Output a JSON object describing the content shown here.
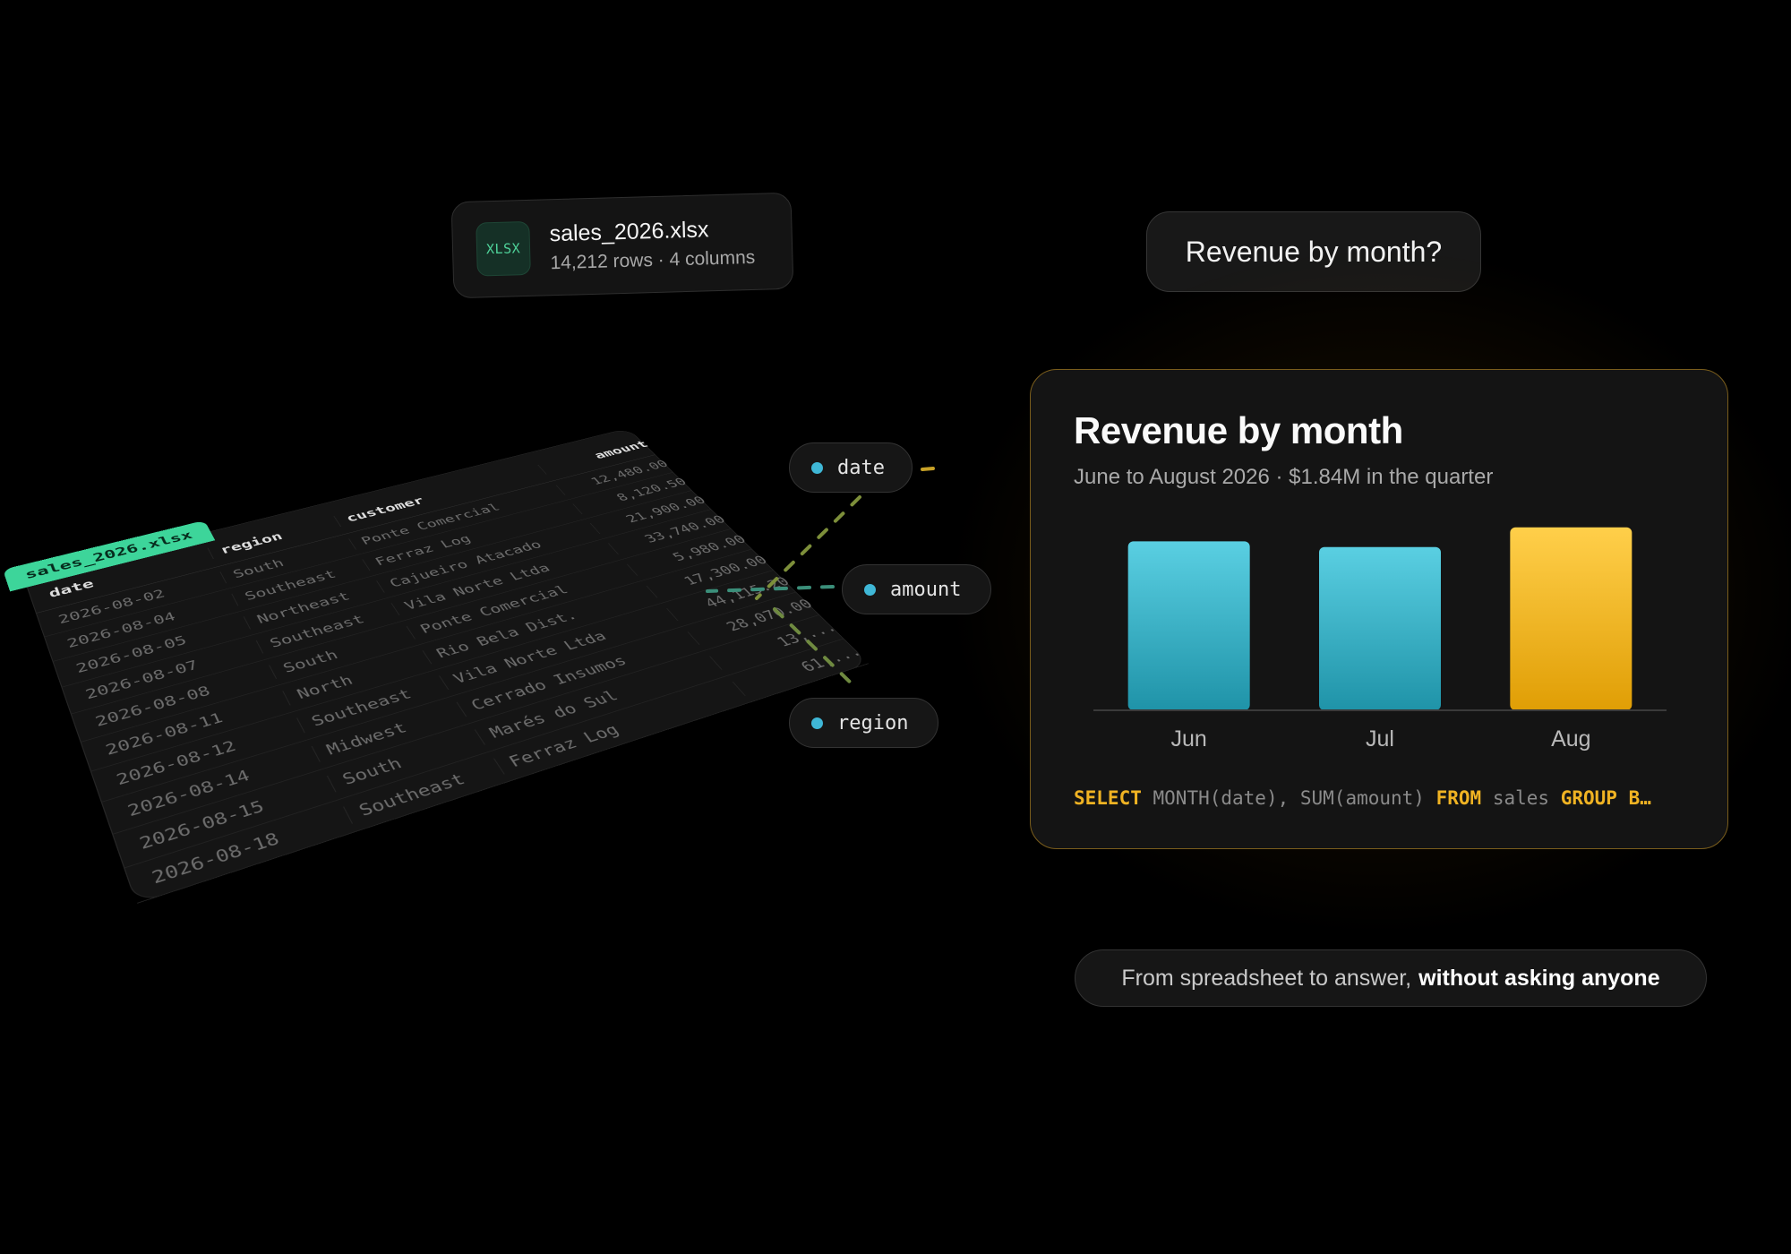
{
  "file": {
    "badge": "XLSX",
    "name": "sales_2026.xlsx",
    "meta": "14,212 rows · 4 columns"
  },
  "sheet": {
    "tab_label": "sales_2026.xlsx",
    "columns": [
      "date",
      "region",
      "customer",
      "amount"
    ],
    "rows": [
      [
        "2026-08-02",
        "South",
        "Ponte Comercial",
        "12,480.00"
      ],
      [
        "2026-08-04",
        "Southeast",
        "Ferraz Log",
        "8,120.50"
      ],
      [
        "2026-08-05",
        "Northeast",
        "Cajueiro Atacado",
        "21,900.00"
      ],
      [
        "2026-08-07",
        "Southeast",
        "Vila Norte Ltda",
        "33,740.00"
      ],
      [
        "2026-08-08",
        "South",
        "Ponte Comercial",
        "5,980.00"
      ],
      [
        "2026-08-11",
        "North",
        "Rio Bela Dist.",
        "17,300.00"
      ],
      [
        "2026-08-12",
        "Southeast",
        "Vila Norte Ltda",
        "44,115.20"
      ],
      [
        "2026-08-14",
        "Midwest",
        "Cerrado Insumos",
        "28,070.00"
      ],
      [
        "2026-08-15",
        "South",
        "Marés do Sul",
        "13,..."
      ],
      [
        "2026-08-18",
        "Southeast",
        "Ferraz Log",
        "61,..."
      ]
    ]
  },
  "fields": {
    "date": "date",
    "amount": "amount",
    "region": "region"
  },
  "question": "Revenue by month?",
  "card": {
    "title": "Revenue by month",
    "subtitle": "June to August 2026 · $1.84M in the quarter",
    "sql": {
      "kw1": "SELECT",
      "t1": "MONTH(date), SUM(amount)",
      "kw2": "FROM",
      "t2": "sales",
      "kw3": "GROUP B…"
    }
  },
  "chart_data": {
    "type": "bar",
    "categories": [
      "Jun",
      "Jul",
      "Aug"
    ],
    "values": [
      0.6,
      0.58,
      0.65
    ],
    "ylim": [
      0,
      0.7
    ],
    "grid": false,
    "highlight_index": 2,
    "colors": {
      "default_top": "#5acfe2",
      "default_bottom": "#1f93a8",
      "highlight_top": "#ffcf4a",
      "highlight_bottom": "#e09e05",
      "baseline": "#3a3a3a"
    }
  },
  "tagline": {
    "lead": "From spreadsheet to answer,",
    "emphasis": "without asking anyone"
  }
}
